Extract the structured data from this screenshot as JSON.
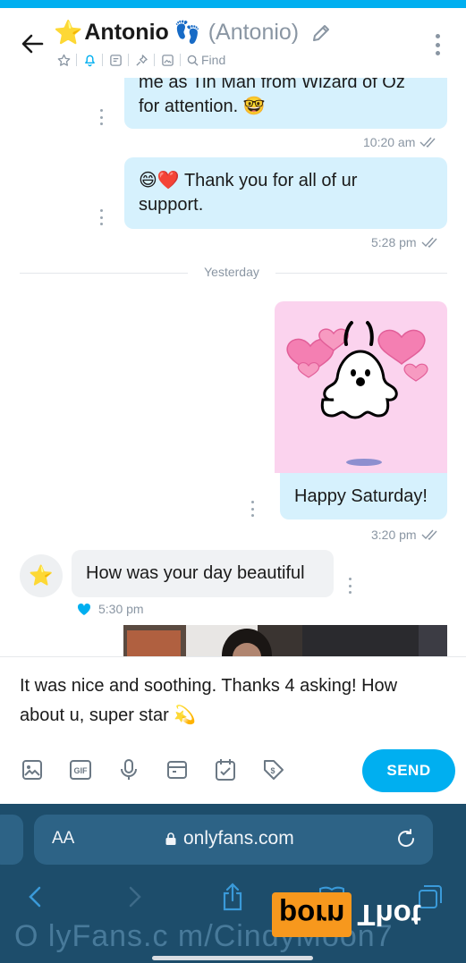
{
  "header": {
    "title_star": "⭐",
    "title_name": "Antonio",
    "title_feet": "👣",
    "title_alias": "(Antonio)",
    "find_label": "Find",
    "icons": [
      "back-arrow-icon",
      "pencil-icon",
      "more-vertical-icon",
      "star-icon",
      "bell-icon",
      "note-icon",
      "pin-icon",
      "media-icon",
      "search-icon"
    ],
    "accent_color": "#00aff0"
  },
  "messages": {
    "m1": {
      "text": "me as Tin Man from Wizard of Oz for attention. 🤓",
      "line1": "me as Tin Man from Wizard of Oz",
      "line2": "for attention. 🤓",
      "time": "10:20 am"
    },
    "m2": {
      "line1": "😄❤️ Thank you for all of ur",
      "line2": "support.",
      "time": "5:28 pm"
    },
    "divider": "Yesterday",
    "m3": {
      "sticker": "pink-heart-ghost-sticker",
      "text": "Happy Saturday!",
      "time": "3:20 pm"
    },
    "m4": {
      "avatar": "⭐",
      "text": "How was your day beautiful",
      "time": "5:30 pm"
    }
  },
  "composer": {
    "line1": "It was nice and soothing. Thanks 4 asking! How",
    "line2": "about u, super star 💫",
    "send_label": "SEND",
    "tools": [
      "image-icon",
      "gif-icon",
      "microphone-icon",
      "vault-icon",
      "schedule-icon",
      "price-tag-icon"
    ]
  },
  "browser": {
    "aa_label": "AA",
    "url": "onlyfans.com",
    "bg_color": "#1d4d6b"
  },
  "watermark": {
    "url_text": "O lyFans.c m/CindyMoon7",
    "brand_a": "porn",
    "brand_b": "Thot"
  }
}
